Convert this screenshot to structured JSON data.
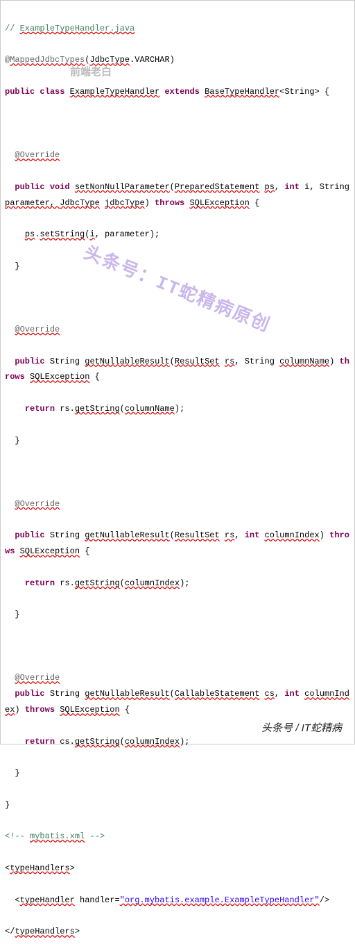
{
  "code": {
    "c0": "// ",
    "c0b": "ExampleTypeHandler.java",
    "a0": "@",
    "a0b": "MappedJdbcTypes",
    "a0c": "(",
    "a0d": "JdbcType",
    "a0e": ".VARCHAR)",
    "kw_public": "public",
    "kw_class": "class",
    "cls": "ExampleTypeHandler",
    "kw_extends": "extends",
    "base": "BaseTypeHandler",
    "lt": "<String> {",
    "override": "@Override",
    "kw_void": "void",
    "m1": "setNonNullParameter",
    "m1p1": "(",
    "m1p2": "PreparedStatement",
    "m1p3": "ps",
    "m1p4": ", ",
    "m1p5": "int",
    "m1p6": " i, String ",
    "m1p7": "parameter, ",
    "m1p8": "JdbcType",
    "m1p9": "jdbcType",
    "m1p10": ") ",
    "kw_throws": "throws",
    "sqlex": "SQLException",
    "brace_open": " {",
    "m1body1": "ps",
    "m1body2": ".",
    "m1body3": "setString",
    "m1body4": "(",
    "m1body5": "i",
    "m1body6": ", parameter);",
    "brace_close": "}",
    "ret_string": "String",
    "m2": "getNullableResult",
    "m2p1": "(",
    "m2p2": "ResultSet",
    "m2p3": "rs",
    "m2p4": ", String ",
    "m2p5": "columnName",
    "m2p6": ") ",
    "kw_return": "return",
    "m2body1": " rs.",
    "m2body2": "getString",
    "m2body3": "(",
    "m2body4": "columnName",
    "m2body5": ");",
    "m3p4": ", ",
    "m3p5": "int",
    "m3p6": "columnIndex",
    "m3p7": ") ",
    "m3body4": "columnIndex",
    "m4p2": "CallableStatement",
    "m4p3": "cs",
    "m4body1": " cs.",
    "xml_comment": "<!-- ",
    "xml_comment2": "mybatis.xml",
    "xml_comment3": " -->",
    "xml_open": "<",
    "xml_th": "typeHandlers",
    "xml_gt": ">",
    "xml_th2": "typeHandler",
    "xml_attr": " handler=",
    "xml_val": "\"org.mybatis.example.ExampleTypeHandler\"",
    "xml_selfclose": "/>",
    "xml_close": "</"
  },
  "watermarks": {
    "w1": "前端老白",
    "w2": "头条号：IT蛇精病原创"
  },
  "footer": "头条号 / IT蛇精病"
}
